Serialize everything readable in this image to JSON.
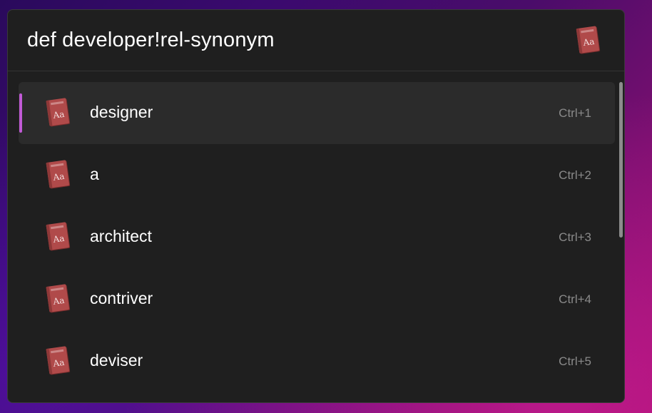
{
  "query": {
    "text": "def developer!rel-synonym"
  },
  "plugin": {
    "icon": "dictionary-book-icon",
    "icon_text": "Aa"
  },
  "results": [
    {
      "title": "designer",
      "shortcut": "Ctrl+1",
      "selected": true,
      "icon": "dictionary-book-icon",
      "icon_text": "Aa"
    },
    {
      "title": "a",
      "shortcut": "Ctrl+2",
      "selected": false,
      "icon": "dictionary-book-icon",
      "icon_text": "Aa"
    },
    {
      "title": "architect",
      "shortcut": "Ctrl+3",
      "selected": false,
      "icon": "dictionary-book-icon",
      "icon_text": "Aa"
    },
    {
      "title": "contriver",
      "shortcut": "Ctrl+4",
      "selected": false,
      "icon": "dictionary-book-icon",
      "icon_text": "Aa"
    },
    {
      "title": "deviser",
      "shortcut": "Ctrl+5",
      "selected": false,
      "icon": "dictionary-book-icon",
      "icon_text": "Aa"
    }
  ],
  "colors": {
    "accent": "#c15ad6",
    "window_bg": "#1f1f1f",
    "selected_row_bg": "#2b2b2b",
    "book_red": "#b04a4a"
  }
}
